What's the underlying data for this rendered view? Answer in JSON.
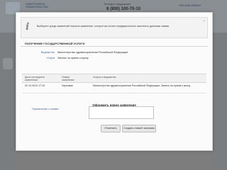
{
  "background": {
    "logo_title": "Электронное правительство",
    "phone_label": "Телефон поддержки",
    "phone": "8 (800) 100-70-10",
    "right_link": "Личный кабинет"
  },
  "modal": {
    "notice_text": "Выберите среди заявлений портала заявление, которое вы хотите предварительно заполнить данными заявки.",
    "close_symbol": "×",
    "section_title": "Получение государственной услуги",
    "fields": [
      {
        "label": "Ведомство",
        "value": "Министерство здравоохранения Российской Федерации"
      },
      {
        "label": "Услуга",
        "value": "Запись на прием к врачу"
      }
    ],
    "table": {
      "headers": [
        "Дата последнего изменения",
        "Номер заявления",
        "Услуга и ведомство"
      ],
      "rows": [
        [
          "02.10.2010 17:19",
          "Черновик",
          "Министерство здравоохранения Российской Федерации. Запись на прием к врачу"
        ]
      ]
    },
    "form_title": "Оформить новое заявление",
    "comment_label": "Примечание к заявке:",
    "comment_value": "",
    "buttons": {
      "cancel": "Отменить",
      "create": "Создать новый черновик"
    }
  }
}
